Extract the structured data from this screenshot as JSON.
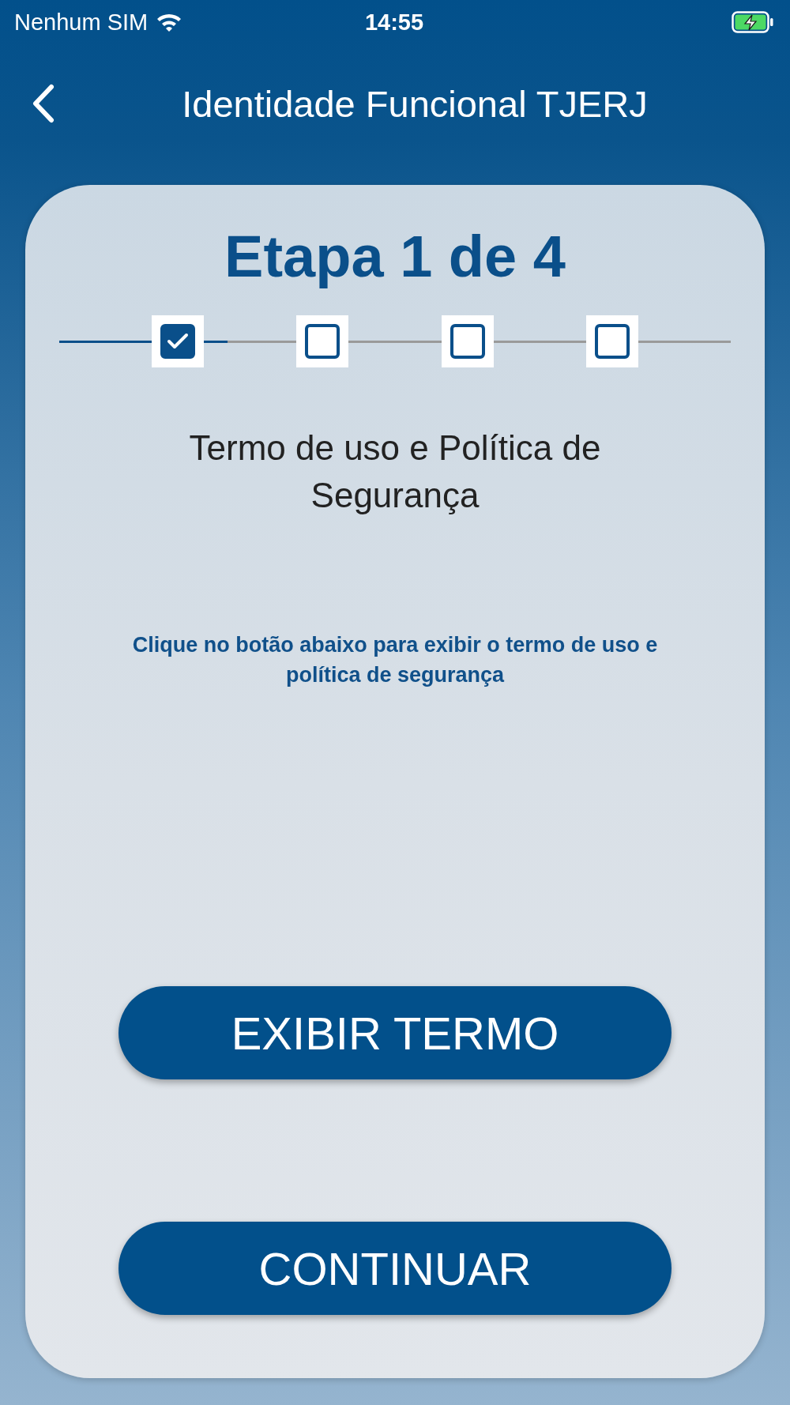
{
  "status_bar": {
    "carrier": "Nenhum SIM",
    "time": "14:55",
    "charging": true
  },
  "header": {
    "title": "Identidade Funcional TJERJ"
  },
  "card": {
    "step_title": "Etapa 1 de 4",
    "steps": [
      {
        "checked": true
      },
      {
        "checked": false
      },
      {
        "checked": false
      },
      {
        "checked": false
      }
    ],
    "subtitle": "Termo de uso e Política de Segurança",
    "note": "Clique no botão abaixo para exibir o termo de uso e política de segurança",
    "buttons": [
      "EXIBIR TERMO",
      "CONTINUAR"
    ]
  }
}
